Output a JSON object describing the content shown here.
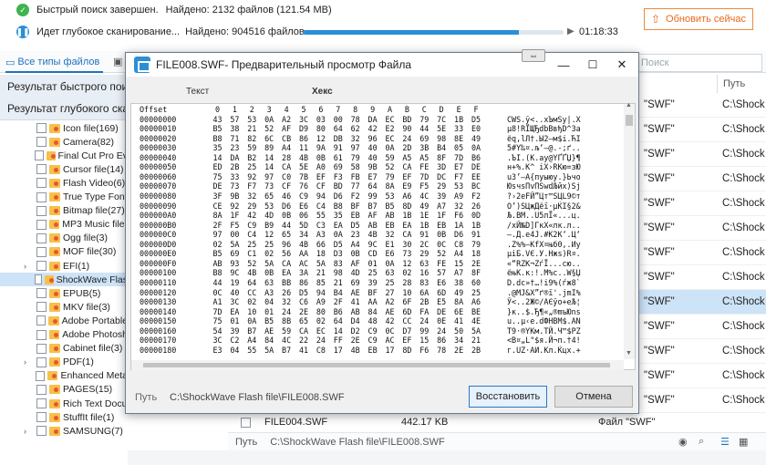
{
  "status": {
    "quick_scan_text": "Быстрый поиск завершен.",
    "quick_scan_found": "Найдено: 2132 файлов (121.54 MB)",
    "deep_scan_text": "Идет глубокое сканирование...",
    "deep_scan_found": "Найдено: 904516 файлов",
    "progress": 0.83,
    "elapsed": "01:18:33",
    "update_button": "Обновить сейчас"
  },
  "tabs": {
    "all_types": "Все типы файлов"
  },
  "search": {
    "placeholder": "Поиск"
  },
  "left": {
    "quick_result": "Результат быстрого поиска",
    "deep_result": "Результат глубокого сканирования",
    "tree": [
      {
        "label": "Icon file(169)",
        "chev": ""
      },
      {
        "label": "Camera(82)",
        "chev": ""
      },
      {
        "label": "Final Cut Pro Ev",
        "chev": ""
      },
      {
        "label": "Cursor file(14)",
        "chev": ""
      },
      {
        "label": "Flash Video(6)",
        "chev": ""
      },
      {
        "label": "True Type Font",
        "chev": ""
      },
      {
        "label": "Bitmap file(27)",
        "chev": ""
      },
      {
        "label": "MP3 Music file(",
        "chev": ""
      },
      {
        "label": "Ogg file(3)",
        "chev": ""
      },
      {
        "label": "MOF file(30)",
        "chev": ""
      },
      {
        "label": "EFI(1)",
        "chev": "›"
      },
      {
        "label": "ShockWave Flas",
        "chev": ""
      },
      {
        "label": "EPUB(5)",
        "chev": ""
      },
      {
        "label": "MKV file(3)",
        "chev": ""
      },
      {
        "label": "Adobe Portable",
        "chev": ""
      },
      {
        "label": "Adobe Photosh",
        "chev": ""
      },
      {
        "label": "Cabinet file(3)",
        "chev": ""
      },
      {
        "label": "PDF(1)",
        "chev": "›"
      },
      {
        "label": "Enhanced Meta",
        "chev": ""
      },
      {
        "label": "PAGES(15)",
        "chev": ""
      },
      {
        "label": "Rich Text Docu",
        "chev": ""
      },
      {
        "label": "StuffIt file(1)",
        "chev": ""
      },
      {
        "label": "SAMSUNG(7)",
        "chev": "›"
      }
    ]
  },
  "right": {
    "path_header": "Путь",
    "rows": [
      {
        "type": "\"SWF\"",
        "path": "C:\\Shock"
      },
      {
        "type": "\"SWF\"",
        "path": "C:\\Shock"
      },
      {
        "type": "\"SWF\"",
        "path": "C:\\Shock"
      },
      {
        "type": "\"SWF\"",
        "path": "C:\\Shock"
      },
      {
        "type": "\"SWF\"",
        "path": "C:\\Shock"
      },
      {
        "type": "\"SWF\"",
        "path": "C:\\Shock"
      },
      {
        "type": "\"SWF\"",
        "path": "C:\\Shock"
      },
      {
        "type": "\"SWF\"",
        "path": "C:\\Shock"
      },
      {
        "type": "\"SWF\"",
        "path": "C:\\Shock"
      },
      {
        "type": "\"SWF\"",
        "path": "C:\\Shock"
      },
      {
        "type": "\"SWF\"",
        "path": "C:\\Shock"
      },
      {
        "type": "\"SWF\"",
        "path": "C:\\Shock"
      },
      {
        "type": "\"SWF\"",
        "path": "C:\\Shock"
      }
    ]
  },
  "under_row": {
    "name": "FILE004.SWF",
    "size": "442.17 KB",
    "type": "Файл \"SWF\"",
    "path": "C:\\Shock"
  },
  "bottom": {
    "path_label": "Путь",
    "path_value": "C:\\ShockWave Flash file\\FILE008.SWF"
  },
  "dialog": {
    "title": "FILE008.SWF- Предварительный просмотр Файла",
    "label_text": "Текст",
    "label_hex": "Хекс",
    "header": {
      "offset": "Offset",
      "cols": [
        "0",
        "1",
        "2",
        "3",
        "4",
        "5",
        "6",
        "7",
        "8",
        "9",
        "A",
        "B",
        "C",
        "D",
        "E",
        "F"
      ]
    },
    "rows": [
      {
        "o": "00000000",
        "b": [
          "43",
          "57",
          "53",
          "0A",
          "A2",
          "3C",
          "03",
          "00",
          "78",
          "DA",
          "EC",
          "BD",
          "79",
          "7C",
          "1B",
          "D5"
        ],
        "t": "CWS.ў<..xЪмЅy|.Х"
      },
      {
        "o": "00000010",
        "b": [
          "B5",
          "38",
          "21",
          "52",
          "AF",
          "D9",
          "80",
          "64",
          "62",
          "42",
          "E2",
          "90",
          "44",
          "5E",
          "33",
          "E0"
        ],
        "t": "µ8!RЇЩЂdbBвђD^3а"
      },
      {
        "o": "00000020",
        "b": [
          "B8",
          "71",
          "82",
          "6C",
          "CB",
          "86",
          "12",
          "DB",
          "32",
          "96",
          "EC",
          "24",
          "69",
          "98",
          "8E",
          "49"
        ],
        "t": "ёq‚lЛ†.Ы2–м$i.ЋI"
      },
      {
        "o": "00000030",
        "b": [
          "35",
          "23",
          "59",
          "89",
          "A4",
          "11",
          "9A",
          "91",
          "97",
          "40",
          "0A",
          "2D",
          "3B",
          "B4",
          "05",
          "0A"
        ],
        "t": "5#Y‰¤.љ‘—@.-;ґ.."
      },
      {
        "o": "00000040",
        "b": [
          "14",
          "DA",
          "B2",
          "14",
          "28",
          "4B",
          "0B",
          "61",
          "79",
          "40",
          "59",
          "A5",
          "A5",
          "8F",
          "7D",
          "B6"
        ],
        "t": ".ЪІ.(K.ay@YҐҐЏ}¶"
      },
      {
        "o": "00000050",
        "b": [
          "ED",
          "2B",
          "25",
          "14",
          "CA",
          "5E",
          "A0",
          "69",
          "58",
          "9B",
          "52",
          "CA",
          "FE",
          "3D",
          "E7",
          "DE"
        ],
        "t": "н+%.К^ iX›RКю=зЮ"
      },
      {
        "o": "00000060",
        "b": [
          "75",
          "33",
          "92",
          "97",
          "C0",
          "7B",
          "EF",
          "F3",
          "FB",
          "E7",
          "79",
          "EF",
          "7D",
          "DC",
          "F7",
          "EE"
        ],
        "t": "u3’—А{пуыюy.}Ьчо"
      },
      {
        "o": "00000070",
        "b": [
          "DE",
          "73",
          "F7",
          "73",
          "CF",
          "76",
          "CF",
          "BD",
          "77",
          "64",
          "8A",
          "E9",
          "F5",
          "29",
          "53",
          "BC"
        ],
        "t": "ЮsчsПvПЅwdЉйх)Sј"
      },
      {
        "o": "00000080",
        "b": [
          "3F",
          "9B",
          "32",
          "65",
          "46",
          "C9",
          "94",
          "D6",
          "F2",
          "99",
          "53",
          "A6",
          "4C",
          "39",
          "A9",
          "F2"
        ],
        "t": "?›2eFЙ”Цт™SЦL9©т"
      },
      {
        "o": "00000090",
        "b": [
          "CE",
          "92",
          "29",
          "53",
          "D6",
          "E6",
          "C4",
          "B8",
          "BF",
          "B7",
          "B5",
          "8D",
          "49",
          "A7",
          "32",
          "26"
        ],
        "t": "О’)SЦжДёї·µЌI§2&"
      },
      {
        "o": "000000A0",
        "b": [
          "8A",
          "1F",
          "42",
          "4D",
          "0B",
          "06",
          "55",
          "35",
          "EB",
          "AF",
          "AB",
          "1B",
          "1E",
          "1F",
          "F6",
          "0D"
        ],
        "t": "Љ.BM..U5лЇ«...ц."
      },
      {
        "o": "000000B0",
        "b": [
          "2F",
          "F5",
          "C9",
          "B9",
          "44",
          "5D",
          "C3",
          "EA",
          "D5",
          "AB",
          "EB",
          "EA",
          "1B",
          "EB",
          "1A",
          "1B"
        ],
        "t": "/хЙ№D]ГкХ«лк.л.."
      },
      {
        "o": "000000C0",
        "b": [
          "97",
          "00",
          "C4",
          "12",
          "65",
          "34",
          "A3",
          "0A",
          "23",
          "4B",
          "32",
          "CA",
          "91",
          "0B",
          "D6",
          "91"
        ],
        "t": "—.Д.e4Ј.#K2К‘.Ц‘"
      },
      {
        "o": "000000D0",
        "b": [
          "02",
          "5A",
          "25",
          "25",
          "96",
          "4B",
          "66",
          "D5",
          "A4",
          "9C",
          "E1",
          "30",
          "2C",
          "0C",
          "C8",
          "79"
        ],
        "t": ".Z%%–KfХ¤њб0,.Иy"
      },
      {
        "o": "000000E0",
        "b": [
          "B5",
          "69",
          "C1",
          "02",
          "56",
          "AA",
          "18",
          "D3",
          "0B",
          "CD",
          "E6",
          "73",
          "29",
          "52",
          "A4",
          "18"
        ],
        "t": "µiБ.VЄ.У.Нжs)R¤."
      },
      {
        "o": "000000F0",
        "b": [
          "AB",
          "93",
          "52",
          "5A",
          "CA",
          "AC",
          "5A",
          "83",
          "AF",
          "01",
          "0A",
          "12",
          "63",
          "FE",
          "15",
          "2E"
        ],
        "t": "«“RZК¬ZѓЇ...cю.."
      },
      {
        "o": "00000100",
        "b": [
          "B8",
          "9C",
          "4B",
          "0B",
          "EA",
          "3A",
          "21",
          "98",
          "4D",
          "25",
          "63",
          "02",
          "16",
          "57",
          "A7",
          "8F"
        ],
        "t": "ёњK.к:!.M%c..W§Џ"
      },
      {
        "o": "00000110",
        "b": [
          "44",
          "19",
          "64",
          "63",
          "BB",
          "86",
          "85",
          "21",
          "69",
          "39",
          "25",
          "28",
          "83",
          "E6",
          "38",
          "60"
        ],
        "t": "D.dc»†…!i9%(ѓж8`"
      },
      {
        "o": "00000120",
        "b": [
          "0C",
          "40",
          "CC",
          "A3",
          "26",
          "D5",
          "94",
          "B4",
          "AE",
          "BF",
          "27",
          "10",
          "6A",
          "6D",
          "49",
          "25"
        ],
        "t": ".@МЈ&Х”ґ®ї'.jmI%"
      },
      {
        "o": "00000130",
        "b": [
          "A1",
          "3C",
          "02",
          "04",
          "32",
          "C6",
          "A9",
          "2F",
          "41",
          "AA",
          "A2",
          "6F",
          "2B",
          "E5",
          "8A",
          "A6"
        ],
        "t": "Ў<..2Ж©/AЄўo+еЉ¦"
      },
      {
        "o": "00000140",
        "b": [
          "7D",
          "EA",
          "10",
          "01",
          "24",
          "2E",
          "80",
          "B6",
          "AB",
          "84",
          "AE",
          "6D",
          "FA",
          "DE",
          "6E",
          "BE"
        ],
        "t": "}к..$.Ђ¶«„®mъЮnѕ"
      },
      {
        "o": "00000150",
        "b": [
          "75",
          "01",
          "0A",
          "B5",
          "8B",
          "65",
          "02",
          "64",
          "D4",
          "48",
          "42",
          "CC",
          "24",
          "0E",
          "41",
          "4E"
        ],
        "t": "u..µ‹e.dФHBМ$.AN"
      },
      {
        "o": "00000160",
        "b": [
          "54",
          "39",
          "B7",
          "AE",
          "59",
          "CA",
          "EC",
          "14",
          "D2",
          "C9",
          "0C",
          "D7",
          "99",
          "24",
          "50",
          "5A"
        ],
        "t": "T9·®YКм.ТЙ.Ч™$PZ"
      },
      {
        "o": "00000170",
        "b": [
          "3C",
          "C2",
          "A4",
          "84",
          "4C",
          "22",
          "24",
          "FF",
          "2E",
          "C9",
          "AC",
          "EF",
          "15",
          "86",
          "34",
          "21"
        ],
        "t": "<В¤„L\"$я.Й¬п.†4!"
      },
      {
        "o": "00000180",
        "b": [
          "E3",
          "04",
          "55",
          "5A",
          "B7",
          "41",
          "C8",
          "17",
          "4B",
          "EB",
          "17",
          "8D",
          "F6",
          "78",
          "2E",
          "2B"
        ],
        "t": "г.UZ·AИ.Kл.Ќцx.+"
      }
    ],
    "path_label": "Путь",
    "path_value": "C:\\ShockWave Flash file\\FILE008.SWF",
    "restore_button": "Восстановить",
    "cancel_button": "Отмена"
  }
}
